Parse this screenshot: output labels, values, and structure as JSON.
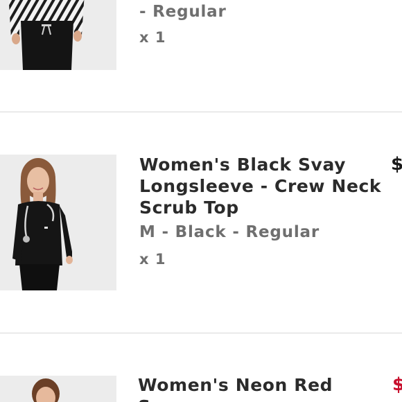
{
  "colors": {
    "title": "#2b2b2b",
    "variant": "#6f6f6f",
    "price_regular": "#1a1a1a",
    "price_sale": "#c8102e",
    "divider": "#d8d8d8"
  },
  "items": [
    {
      "title": "",
      "variant": "- Regular",
      "quantity": "x 1",
      "price": "",
      "image": "model-black-jogger-pants-zebra-top"
    },
    {
      "title": "Women's Black Svay Longsleeve - Crew Neck Scrub Top",
      "variant": "M - Black - Regular",
      "quantity": "x 1",
      "price": "$",
      "image": "model-black-longsleeve-scrub-top"
    },
    {
      "title": "Women's Neon Red Svay",
      "variant": "",
      "quantity": "",
      "price": "$",
      "image": "model-neon-red-scrub-top"
    }
  ]
}
